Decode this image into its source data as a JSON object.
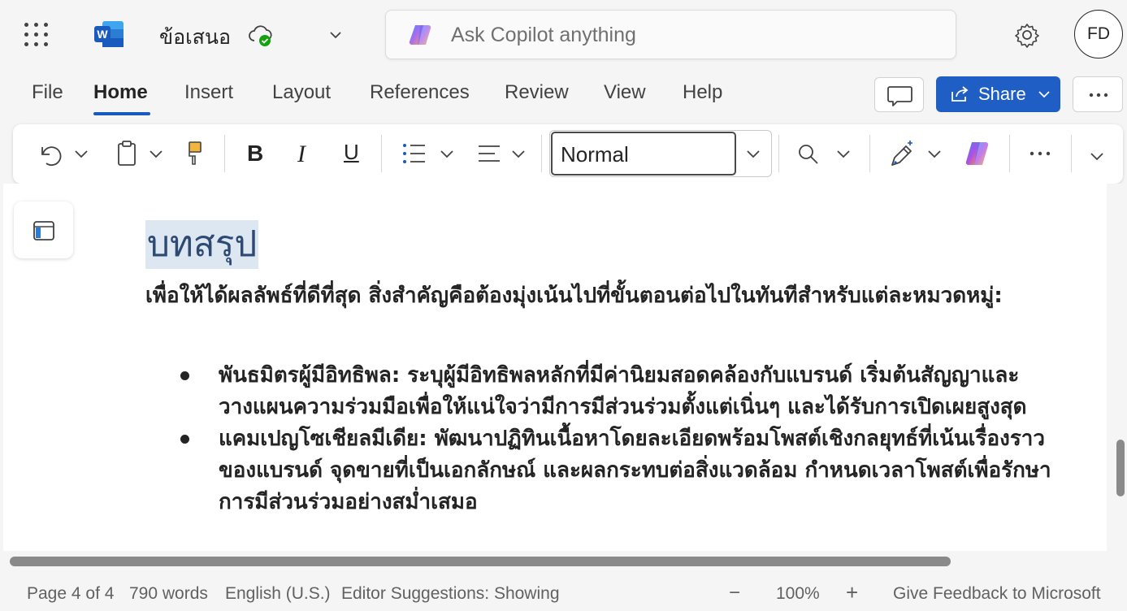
{
  "app": {
    "name": "Word",
    "document_title": "ข้อเสนอ",
    "sync_status": "saved-to-cloud"
  },
  "copilot_search": {
    "placeholder": "Ask Copilot anything"
  },
  "user": {
    "initials": "FD"
  },
  "menu": {
    "tabs": [
      {
        "label": "File",
        "active": false
      },
      {
        "label": "Home",
        "active": true
      },
      {
        "label": "Insert",
        "active": false
      },
      {
        "label": "Layout",
        "active": false
      },
      {
        "label": "References",
        "active": false
      },
      {
        "label": "Review",
        "active": false
      },
      {
        "label": "View",
        "active": false
      },
      {
        "label": "Help",
        "active": false
      }
    ],
    "share_label": "Share"
  },
  "ribbon": {
    "style_value": "Normal",
    "bold_label": "B",
    "italic_label": "I",
    "underline_label": "U",
    "icons": [
      "undo-icon",
      "clipboard-icon",
      "format-painter-icon",
      "bold-icon",
      "italic-icon",
      "underline-icon",
      "bullets-icon",
      "align-icon",
      "find-icon",
      "editor-icon",
      "copilot-icon",
      "more-icon"
    ]
  },
  "document": {
    "heading": "บทสรุป",
    "paragraph": "เพื่อให้ได้ผลลัพธ์ที่ดีที่สุด สิ่งสำคัญคือต้องมุ่งเน้นไปที่ขั้นตอนต่อไปในทันทีสำหรับแต่ละหมวดหมู่:",
    "bullets": [
      "พันธมิตรผู้มีอิทธิพล: ระบุผู้มีอิทธิพลหลักที่มีค่านิยมสอดคล้องกับแบรนด์ เริ่มต้นสัญญาและวางแผนความร่วมมือเพื่อให้แน่ใจว่ามีการมีส่วนร่วมตั้งแต่เนิ่นๆ และได้รับการเปิดเผยสูงสุด",
      "แคมเปญโซเชียลมีเดีย: พัฒนาปฏิทินเนื้อหาโดยละเอียดพร้อมโพสต์เชิงกลยุทธ์ที่เน้นเรื่องราวของแบรนด์ จุดขายที่เป็นเอกลักษณ์ และผลกระทบต่อสิ่งแวดล้อม กำหนดเวลาโพสต์เพื่อรักษาการมีส่วนร่วมอย่างสม่ำเสมอ"
    ]
  },
  "status": {
    "page": "Page 4 of 4",
    "words": "790 words",
    "language": "English (U.S.)",
    "editor": "Editor Suggestions: Showing",
    "zoom_out": "−",
    "zoom": "100%",
    "zoom_in": "+",
    "feedback": "Give Feedback to Microsoft"
  },
  "colors": {
    "accent": "#185abd",
    "share_bg": "#1f5fc5",
    "heading_color": "#2e4a72",
    "heading_highlight": "#dde7f2"
  }
}
